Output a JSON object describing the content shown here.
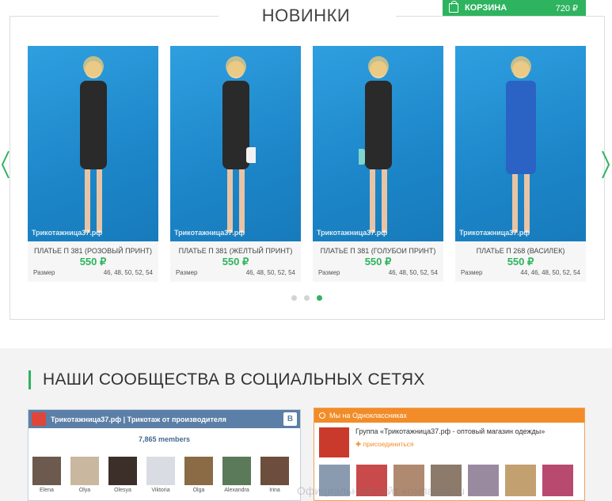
{
  "cart": {
    "label": "КОРЗИНА",
    "total": "720 ₽"
  },
  "new_section": {
    "title": "НОВИНКИ"
  },
  "products": [
    {
      "name": "ПЛАТЬЕ П 381 (РОЗОВЫЙ ПРИНТ)",
      "price": "550 ₽",
      "size_label": "Размер",
      "sizes": "46, 48, 50, 52, 54",
      "watermark": "Трикотажница37.рф",
      "dress_color": "#2a2a2a"
    },
    {
      "name": "ПЛАТЬЕ П 381 (ЖЕЛТЫЙ ПРИНТ)",
      "price": "550 ₽",
      "size_label": "Размер",
      "sizes": "46, 48, 50, 52, 54",
      "watermark": "Трикотажница37.рф",
      "dress_color": "#2a2a2a"
    },
    {
      "name": "ПЛАТЬЕ П 381 (ГОЛУБОИ ПРИНТ)",
      "price": "550 ₽",
      "size_label": "Размер",
      "sizes": "46, 48, 50, 52, 54",
      "watermark": "Трикотажница37.рф",
      "dress_color": "#2a2a2a"
    },
    {
      "name": "ПЛАТЬЕ П 268 (ВАСИЛЕК)",
      "price": "550 ₽",
      "size_label": "Размер",
      "sizes": "44, 46, 48, 50, 52, 54",
      "watermark": "Трикотажница37.рф",
      "dress_color": "#2b63c4"
    }
  ],
  "social": {
    "title": "НАШИ СООБЩЕСТВА В СОЦИАЛЬНЫХ СЕТЯХ",
    "vk": {
      "group_title": "Трикотажница37.рф | Трикотаж от производителя",
      "button": "B",
      "members": "7,865 members",
      "people": [
        "Elena",
        "Olya",
        "Olesya",
        "Viktoria",
        "Olga",
        "Alexandra",
        "Irina"
      ]
    },
    "ok": {
      "header": "Мы на Одноклассниках",
      "group_text": "Группа «Трикотажница37.рф - оптовый магазин одежды»",
      "join": "присоединиться"
    }
  },
  "watermark": "Официальный-сайт-компании.ru"
}
